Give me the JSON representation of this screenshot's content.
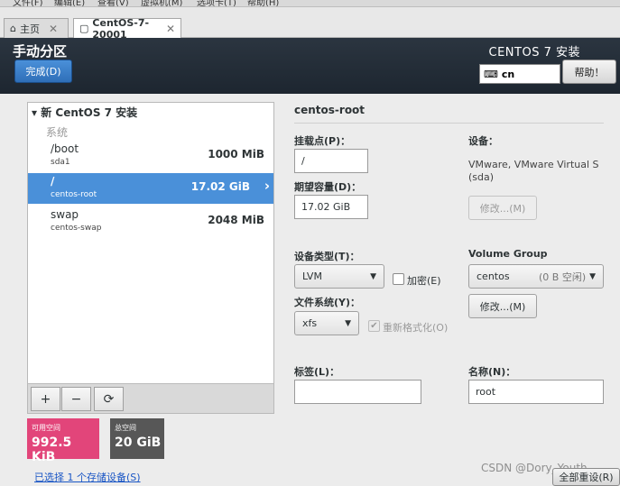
{
  "vmware": {
    "menu": [
      "文件(F)",
      "编辑(E)",
      "查看(V)",
      "虚拟机(M)",
      "选项卡(T)",
      "帮助(H)"
    ],
    "tabs": [
      {
        "label": "主页",
        "icon": "home-icon"
      },
      {
        "label": "CentOS-7-20001",
        "icon": "vm-icon"
      }
    ]
  },
  "header": {
    "title": "手动分区",
    "done_label": "完成(D)",
    "product": "CENTOS 7 安装",
    "keyboard_layout": "cn",
    "help_label": "帮助！"
  },
  "left": {
    "install_title": "新 CentOS 7 安装",
    "system_label": "系统",
    "mounts": [
      {
        "name": "/boot",
        "device": "sda1",
        "size": "1000 MiB",
        "selected": false
      },
      {
        "name": "/",
        "device": "centos-root",
        "size": "17.02 GiB",
        "selected": true
      },
      {
        "name": "swap",
        "device": "centos-swap",
        "size": "2048 MiB",
        "selected": false
      }
    ],
    "toolbar": {
      "add": "+",
      "remove": "−",
      "refresh": "⟳"
    },
    "available": {
      "label": "可用空间",
      "value": "992.5 KiB",
      "color": "#e2457a"
    },
    "total": {
      "label": "总空间",
      "value": "20 GiB",
      "color": "#575757"
    },
    "storage_link": "已选择 1 个存储设备(S)"
  },
  "detail": {
    "title": "centos-root",
    "mount_point_label": "挂载点(P)：",
    "mount_point_value": "/",
    "capacity_label": "期望容量(D)：",
    "capacity_value": "17.02 GiB",
    "device_label": "设备：",
    "device_text_1": "VMware, VMware Virtual S",
    "device_text_2": "(sda)",
    "modify_device_label": "修改...(M)",
    "device_type_label": "设备类型(T)：",
    "device_type_value": "LVM",
    "encrypt_label": "加密(E)",
    "vg_label": "Volume Group",
    "vg_name": "centos",
    "vg_free": "(0 B 空闲)",
    "modify_vg_label": "修改...(M)",
    "fs_label": "文件系统(Y)：",
    "fs_value": "xfs",
    "reformat_label": "重新格式化(O)",
    "tag_label": "标签(L)：",
    "tag_value": "",
    "name_label": "名称(N)：",
    "name_value": "root"
  },
  "footer": {
    "reset_label": "全部重设(R)",
    "watermark": "CSDN @Dory_Youth"
  },
  "colors": {
    "accent": "#4a90d9",
    "available": "#e2457a",
    "total": "#575757",
    "header": "#1d2630"
  }
}
